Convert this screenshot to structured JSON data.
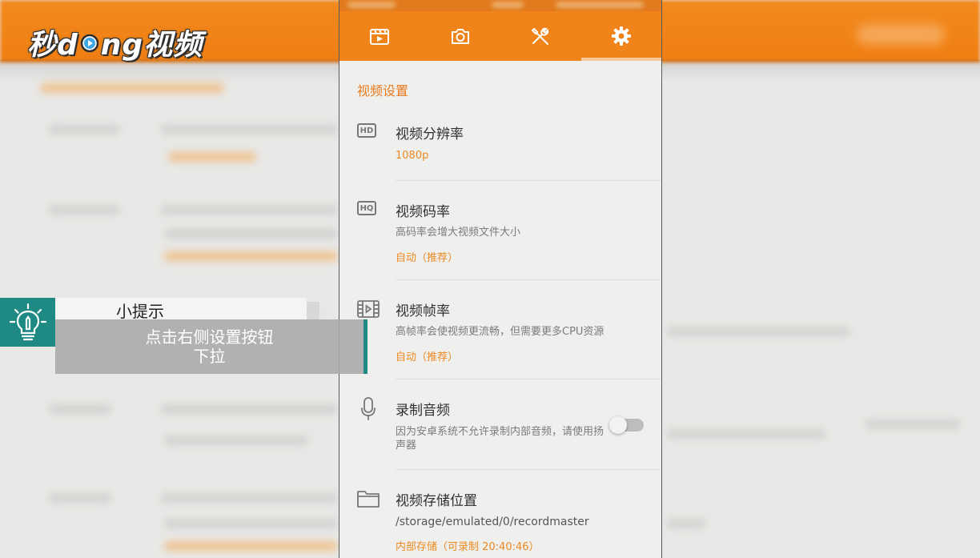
{
  "brand": {
    "logo_left": "秒d",
    "logo_right": "ng视频",
    "colors": {
      "orange": "#f08319",
      "teal": "#1f8a84",
      "value_orange": "#ec8a22"
    }
  },
  "tabs": [
    {
      "icon": "video-clapper-icon"
    },
    {
      "icon": "camera-icon"
    },
    {
      "icon": "tools-icon"
    },
    {
      "icon": "gear-icon",
      "active": true
    }
  ],
  "settings": {
    "section_title": "视频设置",
    "items": [
      {
        "icon": "hd-icon",
        "badge": "HD",
        "title": "视频分辨率",
        "value": "1080p"
      },
      {
        "icon": "hq-icon",
        "badge": "HQ",
        "title": "视频码率",
        "description": "高码率会增大视频文件大小",
        "value": "自动（推荐）"
      },
      {
        "icon": "film-frame-icon",
        "title": "视频帧率",
        "description": "高帧率会使视频更流畅，但需要更多CPU资源",
        "value": "自动（推荐）"
      },
      {
        "icon": "microphone-icon",
        "title": "录制音频",
        "description": "因为安卓系统不允许录制内部音频，请使用扬声器",
        "toggle_on": false
      },
      {
        "icon": "folder-icon",
        "title": "视频存储位置",
        "description": "/storage/emulated/0/recordmaster",
        "value": "内部存储（可录制 20:40:46）"
      }
    ]
  },
  "tip": {
    "title": "小提示",
    "line1": "点击右侧设置按钮",
    "line2": "下拉"
  }
}
